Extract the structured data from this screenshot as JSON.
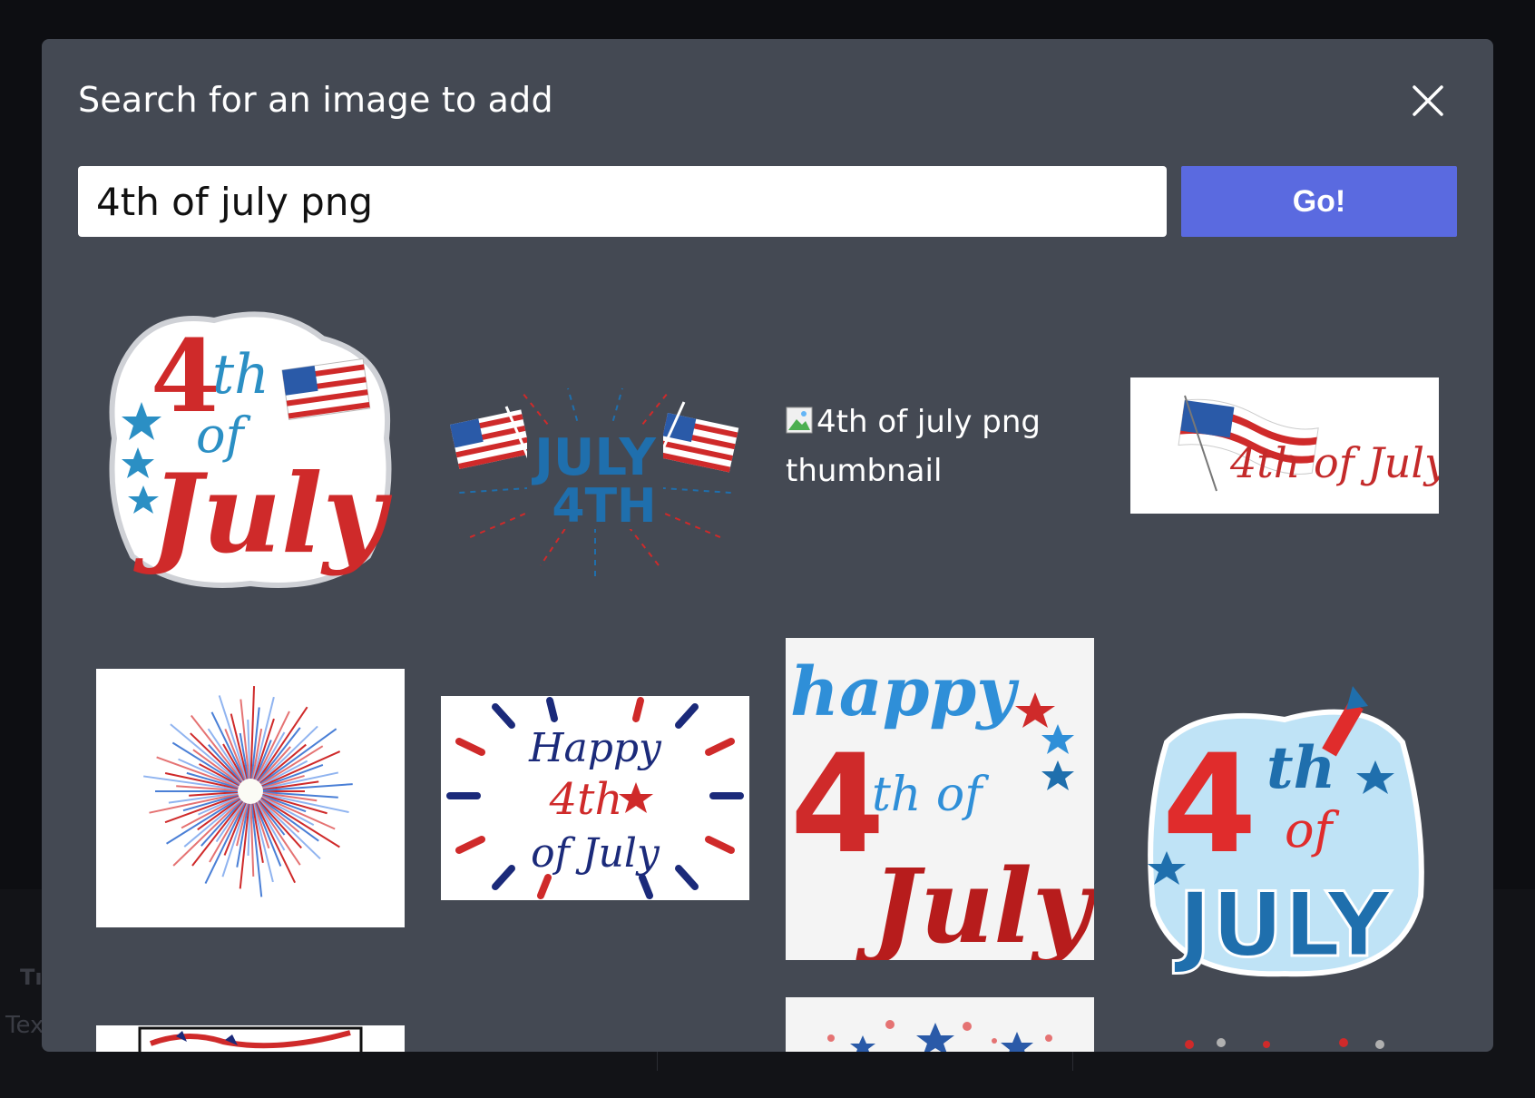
{
  "dialog": {
    "title": "Search for an image to add",
    "close_icon": "close-x-icon"
  },
  "search": {
    "value": "4th of july png",
    "button_label": "Go!"
  },
  "results": [
    {
      "alt": "4th of july png thumbnail",
      "lettering": "4th of July",
      "status": "loaded"
    },
    {
      "alt": "4th of july png thumbnail",
      "lettering": "JULY 4TH",
      "status": "loaded"
    },
    {
      "alt": "4th of july png thumbnail",
      "status": "broken"
    },
    {
      "alt": "4th of july png thumbnail",
      "lettering": "4th of July",
      "status": "loaded"
    },
    {
      "alt": "4th of july png thumbnail",
      "status": "loaded"
    },
    {
      "alt": "4th of july png thumbnail",
      "lettering": "Happy 4th of July",
      "status": "loaded"
    },
    {
      "alt": "4th of july png thumbnail",
      "lettering": "happy 4th of July",
      "status": "loaded"
    },
    {
      "alt": "4th of july png thumbnail",
      "lettering": "4th of JULY",
      "status": "loaded"
    },
    {
      "alt": "4th of july png thumbnail",
      "status": "loaded"
    },
    {
      "alt": "4th of july png thumbnail",
      "status": "loaded"
    },
    {
      "alt": "4th of july png thumbnail",
      "status": "loaded"
    }
  ],
  "background": {
    "label_fragment": "Tı",
    "sublabel_fragment": "Tex"
  },
  "colors": {
    "overlay": "#0d0e12",
    "modal": "#444953",
    "go_button": "#5a6ae0",
    "patriot_red": "#cf2a2a",
    "patriot_blue": "#1f6fad"
  }
}
